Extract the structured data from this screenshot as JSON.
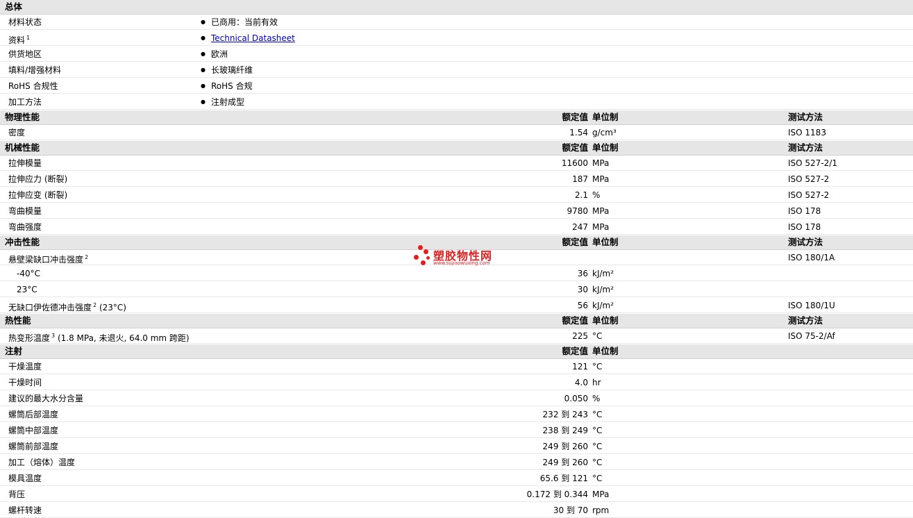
{
  "general": {
    "header": "总体",
    "rows": [
      {
        "name": "材料状态",
        "value": "已商用：当前有效"
      },
      {
        "name": "资料",
        "sup": "1",
        "value": "Technical Datasheet",
        "link": true
      },
      {
        "name": "供货地区",
        "value": "欧洲"
      },
      {
        "name": "填料/增强材料",
        "value": "长玻璃纤维"
      },
      {
        "name": "RoHS 合规性",
        "value": "RoHS 合规"
      },
      {
        "name": "加工方法",
        "value": "注射成型"
      }
    ]
  },
  "columns": {
    "value": "额定值",
    "unit": "单位制",
    "test": "测试方法"
  },
  "sections": [
    {
      "header": "物理性能",
      "show_test": true,
      "rows": [
        {
          "name": "密度",
          "value": "1.54",
          "unit": "g/cm³",
          "test": "ISO 1183"
        }
      ]
    },
    {
      "header": "机械性能",
      "show_test": true,
      "rows": [
        {
          "name": "拉伸模量",
          "value": "11600",
          "unit": "MPa",
          "test": "ISO 527-2/1"
        },
        {
          "name": "拉伸应力 (断裂)",
          "value": "187",
          "unit": "MPa",
          "test": "ISO 527-2"
        },
        {
          "name": "拉伸应变 (断裂)",
          "value": "2.1",
          "unit": "%",
          "test": "ISO 527-2"
        },
        {
          "name": "弯曲模量",
          "value": "9780",
          "unit": "MPa",
          "test": "ISO 178"
        },
        {
          "name": "弯曲强度",
          "value": "247",
          "unit": "MPa",
          "test": "ISO 178"
        }
      ]
    },
    {
      "header": "冲击性能",
      "show_test": true,
      "rows": [
        {
          "name": "悬壁梁缺口冲击强度",
          "sup": "2",
          "value": "",
          "unit": "",
          "test": "ISO 180/1A"
        },
        {
          "name": "-40°C",
          "sub": true,
          "value": "36",
          "unit": "kJ/m²",
          "test": ""
        },
        {
          "name": "23°C",
          "sub": true,
          "value": "30",
          "unit": "kJ/m²",
          "test": ""
        },
        {
          "name": "无缺口伊佐德冲击强度",
          "sup": "2",
          "suffix": "(23°C)",
          "value": "56",
          "unit": "kJ/m²",
          "test": "ISO 180/1U"
        }
      ]
    },
    {
      "header": "热性能",
      "show_test": true,
      "rows": [
        {
          "name": "热变形温度",
          "sup": "3",
          "suffix": "(1.8 MPa, 未退火, 64.0 mm 跨距)",
          "value": "225",
          "unit": "°C",
          "test": "ISO 75-2/Af"
        }
      ]
    },
    {
      "header": "注射",
      "show_test": false,
      "rows": [
        {
          "name": "干燥温度",
          "value": "121",
          "unit": "°C",
          "test": ""
        },
        {
          "name": "干燥时间",
          "value": "4.0",
          "unit": "hr",
          "test": ""
        },
        {
          "name": "建议的最大水分含量",
          "value": "0.050",
          "unit": "%",
          "test": ""
        },
        {
          "name": "螺筒后部温度",
          "value": "232 到 243",
          "unit": "°C",
          "test": ""
        },
        {
          "name": "螺筒中部温度",
          "value": "238 到 249",
          "unit": "°C",
          "test": ""
        },
        {
          "name": "螺筒前部温度",
          "value": "249 到 260",
          "unit": "°C",
          "test": ""
        },
        {
          "name": "加工（熔体）温度",
          "value": "249 到 260",
          "unit": "°C",
          "test": ""
        },
        {
          "name": "模具温度",
          "value": "65.6 到 121",
          "unit": "°C",
          "test": ""
        },
        {
          "name": "背压",
          "value": "0.172 到 0.344",
          "unit": "MPa",
          "test": ""
        },
        {
          "name": "螺杆转速",
          "value": "30 到 70",
          "unit": "rpm",
          "test": ""
        }
      ]
    }
  ],
  "watermark": {
    "text": "塑胶物性网",
    "url": "www.sujiaowuxing.com",
    "color": "#e81c1c"
  }
}
